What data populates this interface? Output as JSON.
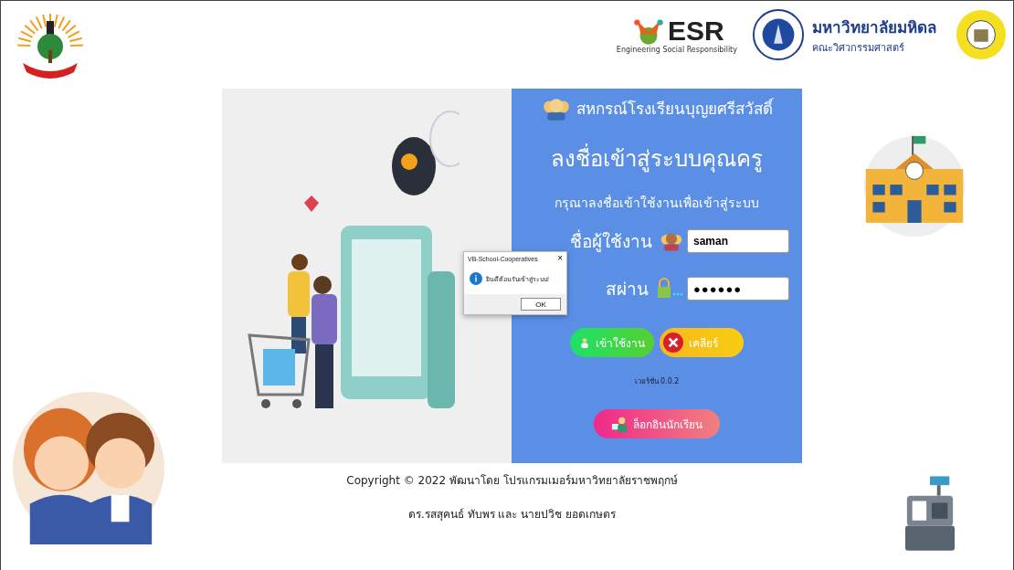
{
  "header": {
    "esr_logo": {
      "word": "ESR",
      "tagline": "Engineering Social Responsibility"
    },
    "university": {
      "name": "มหาวิทยาลัยมหิดล",
      "faculty": "คณะวิศวกรรมศาสตร์"
    }
  },
  "login": {
    "organization": "สหกรณ์โรงเรียนบุญยศรีสวัสดิ์",
    "title": "ลงชื่อเข้าสู่ระบบคุณครู",
    "subtitle": "กรุณาลงชื่อเข้าใช้งานเพื่อเข้าสู่ระบบ",
    "fields": [
      {
        "kind": "user",
        "label": "ชื่อผู้ใช้งาน",
        "value": "saman"
      },
      {
        "kind": "password",
        "label": "สผ่าน",
        "value": "●●●●●●"
      }
    ],
    "buttons": [
      {
        "kind": "login",
        "label": "เข้าใช้งาน"
      },
      {
        "kind": "clear",
        "label": "เคลียร์"
      }
    ],
    "version": "เวอร์ชั่น 0.0.2",
    "student_button": "ล็อกอินนักเรียน"
  },
  "dialog": {
    "title": "VB-School-Cooperatives",
    "close": "×",
    "message": "ยินดีต้อนรับเข้าสู่ระบบ!",
    "ok": "OK"
  },
  "footer": [
    "Copyright © 2022 พัฒนาโดย โปรแกรมเมอร์มหาวิทยาลัยราชพฤกษ์",
    "ดร.รสสุคนธ์ ทับพร และ นายปวิช ยอดเกษตร"
  ]
}
